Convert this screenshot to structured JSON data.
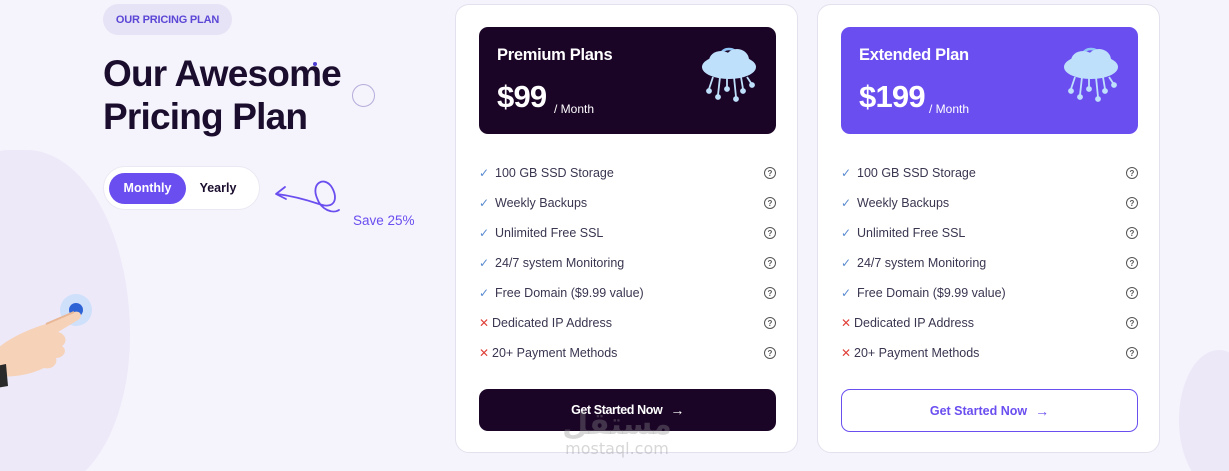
{
  "section": {
    "badge": "OUR PRICING PLAN",
    "title": "Our Awesome Pricing Plan",
    "toggle": {
      "monthly": "Monthly",
      "yearly": "Yearly",
      "selected": "Monthly"
    },
    "save_note": "Save 25%"
  },
  "plans": [
    {
      "name": "Premium Plans",
      "price": "$99",
      "period": "/ Month",
      "icon": "cloud-network-icon",
      "features": [
        {
          "label": "100 GB SSD Storage",
          "included": true
        },
        {
          "label": "Weekly Backups",
          "included": true
        },
        {
          "label": "Unlimited Free SSL",
          "included": true
        },
        {
          "label": "24/7 system Monitoring",
          "included": true
        },
        {
          "label": "Free Domain ($9.99 value)",
          "included": true
        },
        {
          "label": "Dedicated IP Address",
          "included": false
        },
        {
          "label": "20+ Payment Methods",
          "included": false
        }
      ],
      "cta": "Get Started Now"
    },
    {
      "name": "Extended Plan",
      "price": "$199",
      "period": "/ Month",
      "icon": "cloud-network-icon",
      "features": [
        {
          "label": "100 GB SSD Storage",
          "included": true
        },
        {
          "label": "Weekly Backups",
          "included": true
        },
        {
          "label": "Unlimited Free SSL",
          "included": true
        },
        {
          "label": "24/7 system Monitoring",
          "included": true
        },
        {
          "label": "Free Domain ($9.99 value)",
          "included": true
        },
        {
          "label": "Dedicated IP Address",
          "included": false
        },
        {
          "label": "20+ Payment Methods",
          "included": false
        }
      ],
      "cta": "Get Started Now"
    }
  ],
  "marks": {
    "included": "✓",
    "excluded": "✕",
    "help": "?",
    "arrow": "→"
  },
  "watermark": {
    "top": "مستقل",
    "bottom": "mostaql.com"
  },
  "colors": {
    "accent": "#6b4ef0",
    "dark": "#1b0527",
    "excluded": "#e0413a"
  }
}
